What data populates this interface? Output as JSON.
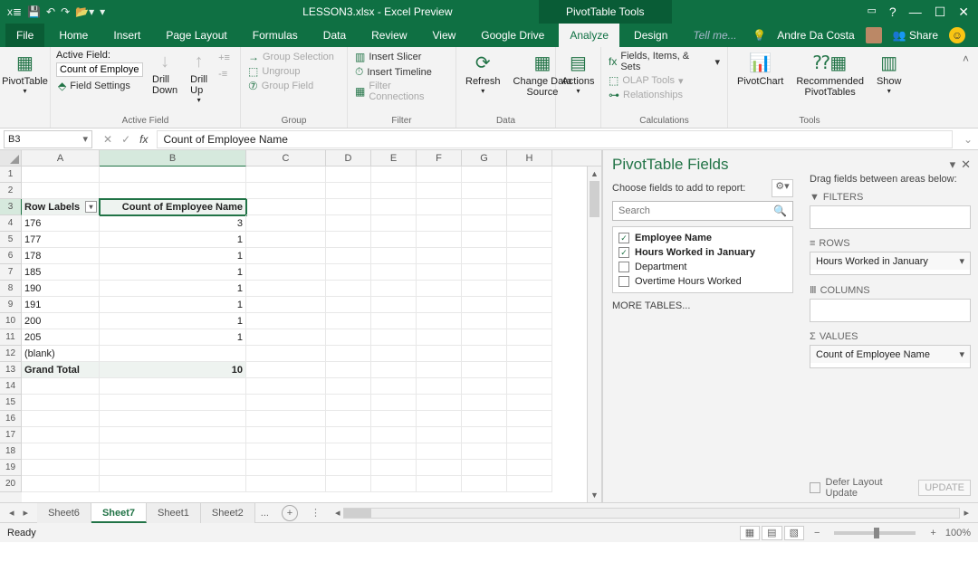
{
  "titlebar": {
    "filename": "LESSON3.xlsx - Excel Preview",
    "context_tab": "PivotTable Tools"
  },
  "window_controls": {
    "help": "?"
  },
  "ribbon_tabs": {
    "file": "File",
    "home": "Home",
    "insert": "Insert",
    "page_layout": "Page Layout",
    "formulas": "Formulas",
    "data": "Data",
    "review": "Review",
    "view": "View",
    "google_drive": "Google Drive",
    "analyze": "Analyze",
    "design": "Design",
    "tell_me": "Tell me...",
    "user": "Andre Da Costa",
    "share": "Share"
  },
  "ribbon": {
    "pivottable": "PivotTable",
    "active_field": {
      "label": "Active Field:",
      "value": "Count of Employe",
      "settings": "Field Settings"
    },
    "drill_down": "Drill\nDown",
    "drill_up": "Drill\nUp",
    "group": {
      "selection": "Group Selection",
      "ungroup": "Ungroup",
      "field": "Group Field"
    },
    "filter": {
      "slicer": "Insert Slicer",
      "timeline": "Insert Timeline",
      "connections": "Filter Connections"
    },
    "data": {
      "refresh": "Refresh",
      "change": "Change Data\nSource"
    },
    "actions": "Actions",
    "calc": {
      "fields": "Fields, Items, & Sets",
      "olap": "OLAP Tools",
      "rel": "Relationships"
    },
    "tools": {
      "chart": "PivotChart",
      "rec": "Recommended\nPivotTables",
      "show": "Show"
    },
    "groups": {
      "af": "Active Field",
      "g": "Group",
      "f": "Filter",
      "d": "Data",
      "c": "Calculations",
      "t": "Tools"
    }
  },
  "formula_bar": {
    "cell_ref": "B3",
    "formula": "Count of Employee Name"
  },
  "columns": [
    "A",
    "B",
    "C",
    "D",
    "E",
    "F",
    "G",
    "H"
  ],
  "rows": {
    "header": {
      "a": "Row Labels",
      "b": "Count of Employee Name"
    },
    "data": [
      {
        "a": "176",
        "b": "3"
      },
      {
        "a": "177",
        "b": "1"
      },
      {
        "a": "178",
        "b": "1"
      },
      {
        "a": "185",
        "b": "1"
      },
      {
        "a": "190",
        "b": "1"
      },
      {
        "a": "191",
        "b": "1"
      },
      {
        "a": "200",
        "b": "1"
      },
      {
        "a": "205",
        "b": "1"
      },
      {
        "a": "(blank)",
        "b": ""
      }
    ],
    "total": {
      "a": "Grand Total",
      "b": "10"
    }
  },
  "pane": {
    "title": "PivotTable Fields",
    "choose": "Choose fields to add to report:",
    "search_ph": "Search",
    "fields": [
      {
        "label": "Employee Name",
        "checked": true
      },
      {
        "label": "Hours Worked in January",
        "checked": true
      },
      {
        "label": "Department",
        "checked": false
      },
      {
        "label": "Overtime Hours Worked",
        "checked": false
      }
    ],
    "more": "MORE TABLES...",
    "drag": "Drag fields between areas below:",
    "areas": {
      "filters": "FILTERS",
      "rows": "ROWS",
      "columns": "COLUMNS",
      "values": "VALUES",
      "rows_chip": "Hours Worked in January",
      "values_chip": "Count of Employee Name"
    },
    "defer": "Defer Layout Update",
    "update": "UPDATE"
  },
  "sheet_tabs": [
    "Sheet6",
    "Sheet7",
    "Sheet1",
    "Sheet2"
  ],
  "sheet_tabs_active": 1,
  "sheet_tabs_more": "...",
  "status": {
    "ready": "Ready",
    "zoom": "100%"
  }
}
